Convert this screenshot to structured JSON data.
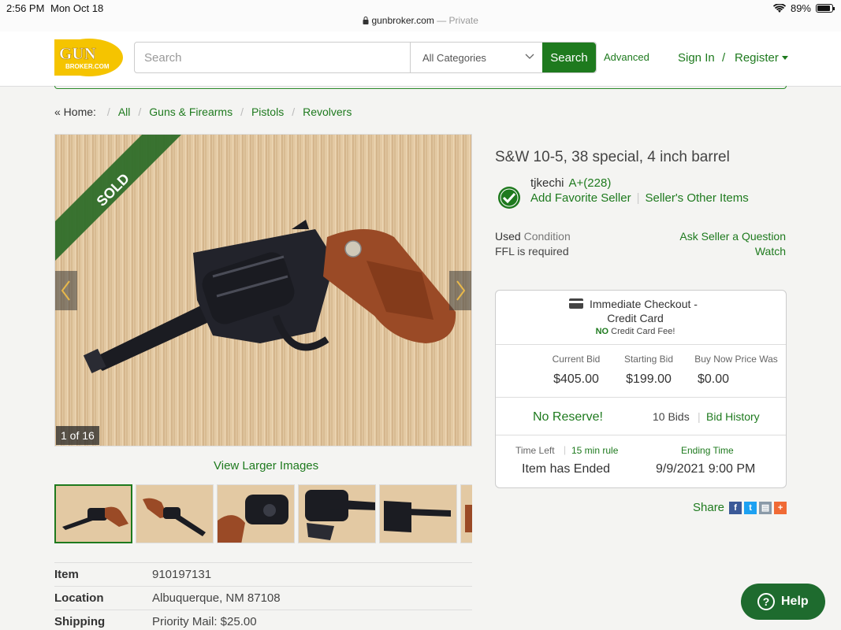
{
  "status_bar": {
    "time": "2:56 PM",
    "date": "Mon Oct 18",
    "battery": "89%",
    "battery_level": 0.89
  },
  "browser": {
    "url": "gunbroker.com",
    "mode": "— Private"
  },
  "header": {
    "logo_line1": "GUN",
    "logo_line2": "BROKER.COM",
    "search_placeholder": "Search",
    "category": "All Categories",
    "search_button": "Search",
    "advanced": "Advanced",
    "sign_in": "Sign In",
    "separator": "/",
    "register": "Register"
  },
  "breadcrumb": {
    "home": "« Home:",
    "items": [
      "All",
      "Guns & Firearms",
      "Pistols",
      "Revolvers"
    ]
  },
  "gallery": {
    "badge": "SOLD",
    "counter": "1 of 16",
    "view_larger": "View Larger Images",
    "thumbnail_count": 6
  },
  "details": [
    {
      "key": "Item",
      "value": "910197131"
    },
    {
      "key": "Location",
      "value": "Albuquerque, NM 87108"
    },
    {
      "key": "Shipping",
      "value": "Priority Mail: $25.00"
    }
  ],
  "listing": {
    "title": "S&W 10-5, 38 special, 4 inch barrel",
    "seller_name": "tjkechi",
    "seller_rating": "A+(228)",
    "add_favorite": "Add Favorite Seller",
    "other_items": "Seller's Other Items",
    "condition_value": "Used",
    "condition_label": "Condition",
    "ffl": "FFL is required",
    "ask_seller": "Ask Seller a Question",
    "watch": "Watch"
  },
  "bidbox": {
    "checkout_line1": "Immediate Checkout -",
    "checkout_line2": "Credit Card",
    "fee_strong": "NO",
    "fee_rest": "Credit Card Fee!",
    "current_bid_label": "Current Bid",
    "current_bid": "$405.00",
    "starting_bid_label": "Starting Bid",
    "starting_bid": "$199.00",
    "buy_now_label": "Buy Now Price Was",
    "buy_now": "$0.00",
    "no_reserve": "No Reserve!",
    "bids": "10 Bids",
    "bid_history": "Bid History",
    "time_left_label": "Time Left",
    "rule": "15 min rule",
    "time_left": "Item has Ended",
    "ending_label": "Ending Time",
    "ending_time": "9/9/2021 9:00 PM"
  },
  "share": {
    "label": "Share",
    "icons": [
      "facebook-icon",
      "twitter-icon",
      "print-icon",
      "more-icon"
    ]
  },
  "help": {
    "label": "Help"
  },
  "colors": {
    "brand_green": "#1e7a1e",
    "logo_yellow": "#f5c400",
    "help_green": "#1e6b2e"
  }
}
